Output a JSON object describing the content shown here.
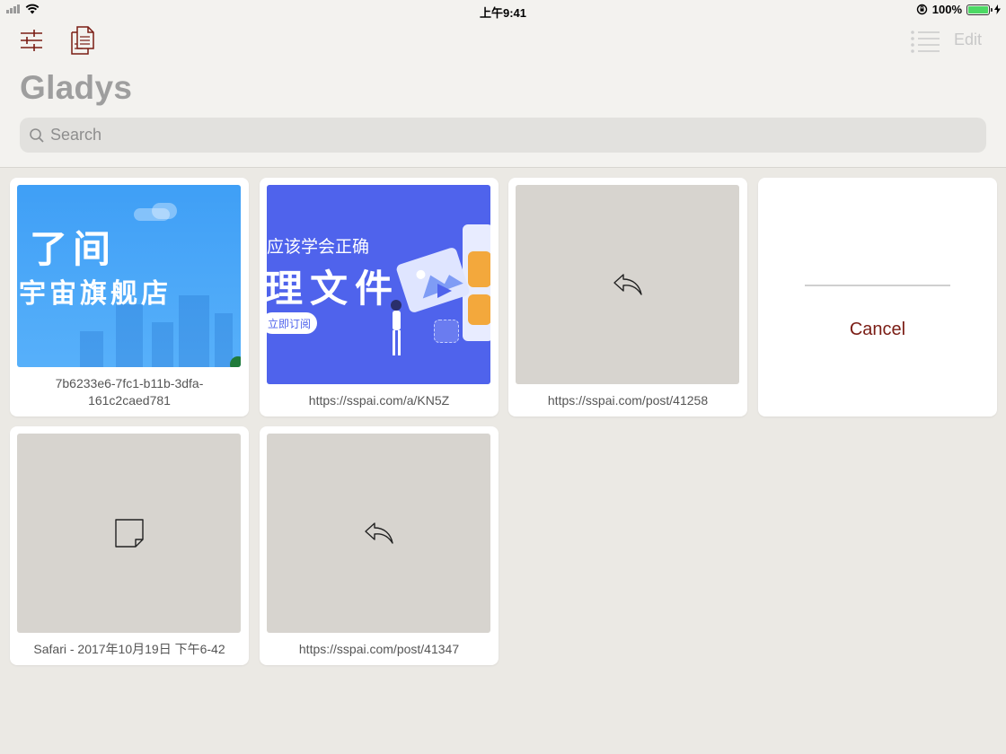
{
  "status_bar": {
    "time": "上午9:41",
    "battery": "100%"
  },
  "navbar": {
    "title": "Gladys",
    "edit_label": "Edit",
    "search_placeholder": "Search"
  },
  "items": [
    {
      "banner_line1": "了间",
      "banner_line2": "宇宙旗舰店",
      "caption": "7b6233e6-7fc1-b11b-3dfa-161c2caed781"
    },
    {
      "banner_line1": "应该学会正确",
      "banner_line2": "理文件",
      "banner_button": "立即订阅",
      "caption": "https://sspai.com/a/KN5Z"
    },
    {
      "caption": "https://sspai.com/post/41258",
      "icon": "reply-arrow-icon"
    },
    {
      "cancel_label": "Cancel"
    },
    {
      "caption": "Safari - 2017年10月19日 下午6-42",
      "icon": "note-icon"
    },
    {
      "caption": "https://sspai.com/post/41347",
      "icon": "reply-arrow-icon"
    }
  ],
  "colors": {
    "accent": "#7a1c14",
    "background": "#ebe9e4",
    "card": "#ffffff",
    "thumb_placeholder": "#d7d4cf"
  }
}
